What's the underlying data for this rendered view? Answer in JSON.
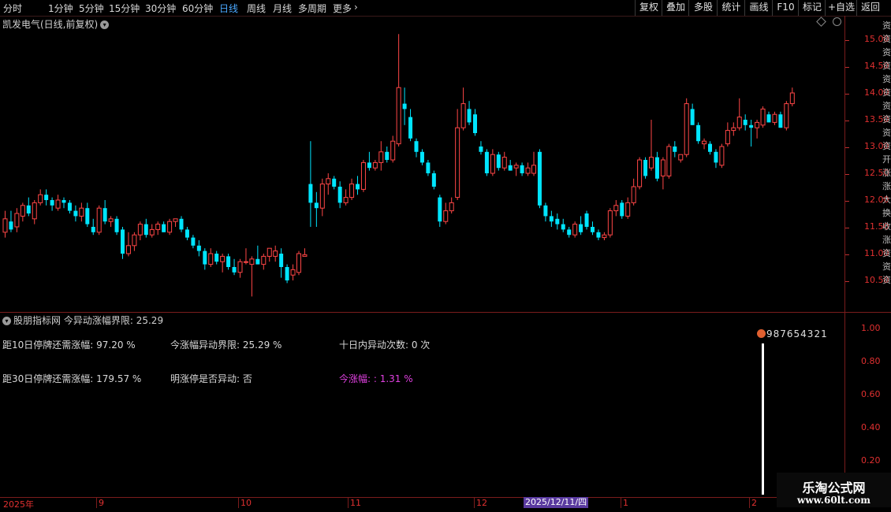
{
  "toolbar": {
    "periods": [
      "分时",
      "1分钟",
      "5分钟",
      "15分钟",
      "30分钟",
      "60分钟",
      "日线",
      "周线",
      "月线",
      "多周期",
      "更多"
    ],
    "active_period": "日线",
    "more_arrow": "›",
    "tools": [
      "复权",
      "叠加",
      "多股",
      "统计",
      "画线",
      "F10",
      "标记",
      "+自选",
      "返回"
    ]
  },
  "price_panel": {
    "title": "凯发电气(日线,前复权)",
    "dropdown_icon": "chevron-down-icon",
    "price_ticks": [
      "15.00",
      "14.50",
      "14.00",
      "13.50",
      "13.00",
      "12.50",
      "12.00",
      "11.50",
      "11.00",
      "10.50"
    ]
  },
  "indicator_panel": {
    "source": "股朋指标网",
    "title_label": "今异动涨幅界限",
    "title_value": "25.29",
    "line1_a": "距10日停牌还需涨幅: 97.20 %",
    "line1_b": "今涨幅异动界限: 25.29 %",
    "line1_c": "十日内异动次数: 0 次",
    "line2_a": "距30日停牌还需涨幅: 179.57 %",
    "line2_b": "明涨停是否异动: 否",
    "line2_c": "今涨幅: : 1.31 %",
    "signal_label": "987654321",
    "ticks": [
      "1.00",
      "0.80",
      "0.60",
      "0.40",
      "0.20"
    ]
  },
  "time_axis": {
    "labels": [
      "2025年",
      "9",
      "10",
      "11",
      "12",
      "1",
      "2"
    ],
    "cursor_date": "2025/12/11/四"
  },
  "right_strip_chars": [
    "资",
    "资",
    "资",
    "资",
    "资",
    "资",
    "资",
    "资",
    "资",
    "资",
    "开",
    "涨",
    "涨",
    "大",
    "换",
    "收",
    "涨",
    "资",
    "资",
    "资"
  ],
  "watermark": {
    "title": "乐淘公式网",
    "url": "www.60lt.com"
  },
  "colors": {
    "up": "#ff4646",
    "down": "#00e5ff",
    "axis": "#7a1c1c",
    "accent": "#4aa8ff",
    "magenta": "#e040e0"
  },
  "chart_data": {
    "type": "candlestick",
    "ylim": [
      10.0,
      15.3
    ],
    "candles": [
      {
        "o": 11.4,
        "h": 11.8,
        "l": 11.3,
        "c": 11.65
      },
      {
        "o": 11.6,
        "h": 11.8,
        "l": 11.4,
        "c": 11.45
      },
      {
        "o": 11.5,
        "h": 11.85,
        "l": 11.4,
        "c": 11.75
      },
      {
        "o": 11.7,
        "h": 11.95,
        "l": 11.6,
        "c": 11.9
      },
      {
        "o": 11.9,
        "h": 12.05,
        "l": 11.7,
        "c": 11.75
      },
      {
        "o": 11.65,
        "h": 12.0,
        "l": 11.55,
        "c": 11.95
      },
      {
        "o": 11.95,
        "h": 12.2,
        "l": 11.9,
        "c": 12.1
      },
      {
        "o": 12.1,
        "h": 12.2,
        "l": 11.9,
        "c": 12.0
      },
      {
        "o": 12.0,
        "h": 12.05,
        "l": 11.8,
        "c": 11.9
      },
      {
        "o": 11.85,
        "h": 12.1,
        "l": 11.8,
        "c": 12.0
      },
      {
        "o": 12.0,
        "h": 12.05,
        "l": 11.85,
        "c": 11.95
      },
      {
        "o": 11.95,
        "h": 12.0,
        "l": 11.75,
        "c": 11.8
      },
      {
        "o": 11.8,
        "h": 11.9,
        "l": 11.6,
        "c": 11.7
      },
      {
        "o": 11.7,
        "h": 11.95,
        "l": 11.6,
        "c": 11.85
      },
      {
        "o": 11.85,
        "h": 11.95,
        "l": 11.5,
        "c": 11.55
      },
      {
        "o": 11.5,
        "h": 11.65,
        "l": 11.35,
        "c": 11.4
      },
      {
        "o": 11.4,
        "h": 11.9,
        "l": 11.35,
        "c": 11.85
      },
      {
        "o": 11.85,
        "h": 12.0,
        "l": 11.55,
        "c": 11.6
      },
      {
        "o": 11.6,
        "h": 11.7,
        "l": 11.5,
        "c": 11.65
      },
      {
        "o": 11.65,
        "h": 11.7,
        "l": 11.35,
        "c": 11.4
      },
      {
        "o": 11.45,
        "h": 11.5,
        "l": 10.9,
        "c": 11.0
      },
      {
        "o": 11.0,
        "h": 11.4,
        "l": 10.95,
        "c": 11.15
      },
      {
        "o": 11.15,
        "h": 11.4,
        "l": 11.05,
        "c": 11.35
      },
      {
        "o": 11.35,
        "h": 11.6,
        "l": 11.25,
        "c": 11.55
      },
      {
        "o": 11.55,
        "h": 11.65,
        "l": 11.3,
        "c": 11.35
      },
      {
        "o": 11.35,
        "h": 11.55,
        "l": 11.3,
        "c": 11.45
      },
      {
        "o": 11.45,
        "h": 11.6,
        "l": 11.35,
        "c": 11.55
      },
      {
        "o": 11.55,
        "h": 11.6,
        "l": 11.4,
        "c": 11.4
      },
      {
        "o": 11.4,
        "h": 11.65,
        "l": 11.35,
        "c": 11.6
      },
      {
        "o": 11.6,
        "h": 11.65,
        "l": 11.5,
        "c": 11.65
      },
      {
        "o": 11.65,
        "h": 11.7,
        "l": 11.4,
        "c": 11.45
      },
      {
        "o": 11.45,
        "h": 11.5,
        "l": 11.25,
        "c": 11.3
      },
      {
        "o": 11.3,
        "h": 11.35,
        "l": 11.1,
        "c": 11.15
      },
      {
        "o": 11.15,
        "h": 11.25,
        "l": 10.95,
        "c": 11.05
      },
      {
        "o": 11.05,
        "h": 11.1,
        "l": 10.7,
        "c": 10.8
      },
      {
        "o": 10.8,
        "h": 11.1,
        "l": 10.75,
        "c": 11.0
      },
      {
        "o": 11.0,
        "h": 11.05,
        "l": 10.8,
        "c": 10.85
      },
      {
        "o": 10.85,
        "h": 11.0,
        "l": 10.65,
        "c": 10.95
      },
      {
        "o": 10.95,
        "h": 11.0,
        "l": 10.7,
        "c": 10.75
      },
      {
        "o": 10.75,
        "h": 10.9,
        "l": 10.6,
        "c": 10.65
      },
      {
        "o": 10.65,
        "h": 10.9,
        "l": 10.55,
        "c": 10.85
      },
      {
        "o": 10.85,
        "h": 11.1,
        "l": 10.8,
        "c": 10.85
      },
      {
        "o": 10.8,
        "h": 10.95,
        "l": 10.2,
        "c": 10.9
      },
      {
        "o": 10.9,
        "h": 11.15,
        "l": 10.8,
        "c": 10.8
      },
      {
        "o": 10.8,
        "h": 11.0,
        "l": 10.7,
        "c": 10.95
      },
      {
        "o": 10.95,
        "h": 11.1,
        "l": 10.85,
        "c": 11.1
      },
      {
        "o": 10.95,
        "h": 11.15,
        "l": 10.85,
        "c": 11.05
      },
      {
        "o": 11.0,
        "h": 11.1,
        "l": 10.55,
        "c": 10.75
      },
      {
        "o": 10.75,
        "h": 10.8,
        "l": 10.45,
        "c": 10.5
      },
      {
        "o": 10.6,
        "h": 10.8,
        "l": 10.5,
        "c": 10.7
      },
      {
        "o": 10.65,
        "h": 11.05,
        "l": 10.6,
        "c": 11.0
      },
      {
        "o": 10.95,
        "h": 11.1,
        "l": 10.95,
        "c": 10.98
      },
      {
        "o": 12.3,
        "h": 13.1,
        "l": 11.5,
        "c": 11.95
      },
      {
        "o": 11.95,
        "h": 12.15,
        "l": 11.5,
        "c": 11.85
      },
      {
        "o": 11.85,
        "h": 12.4,
        "l": 11.7,
        "c": 12.3
      },
      {
        "o": 12.3,
        "h": 12.5,
        "l": 12.1,
        "c": 12.4
      },
      {
        "o": 12.4,
        "h": 12.45,
        "l": 12.2,
        "c": 12.25
      },
      {
        "o": 12.25,
        "h": 12.35,
        "l": 11.85,
        "c": 11.95
      },
      {
        "o": 11.95,
        "h": 12.2,
        "l": 11.9,
        "c": 12.05
      },
      {
        "o": 12.05,
        "h": 12.4,
        "l": 12.0,
        "c": 12.3
      },
      {
        "o": 12.3,
        "h": 12.45,
        "l": 12.1,
        "c": 12.2
      },
      {
        "o": 12.2,
        "h": 12.75,
        "l": 12.15,
        "c": 12.7
      },
      {
        "o": 12.7,
        "h": 12.9,
        "l": 12.55,
        "c": 12.6
      },
      {
        "o": 12.6,
        "h": 12.75,
        "l": 12.55,
        "c": 12.7
      },
      {
        "o": 12.7,
        "h": 13.1,
        "l": 12.55,
        "c": 12.9
      },
      {
        "o": 12.9,
        "h": 13.0,
        "l": 12.7,
        "c": 12.75
      },
      {
        "o": 12.75,
        "h": 13.2,
        "l": 12.7,
        "c": 13.1
      },
      {
        "o": 13.05,
        "h": 15.1,
        "l": 13.0,
        "c": 14.1
      },
      {
        "o": 13.8,
        "h": 14.1,
        "l": 13.4,
        "c": 13.7
      },
      {
        "o": 13.55,
        "h": 13.7,
        "l": 13.1,
        "c": 13.15
      },
      {
        "o": 13.1,
        "h": 13.15,
        "l": 12.8,
        "c": 12.9
      },
      {
        "o": 12.9,
        "h": 12.95,
        "l": 12.65,
        "c": 12.7
      },
      {
        "o": 12.7,
        "h": 12.75,
        "l": 12.45,
        "c": 12.5
      },
      {
        "o": 12.5,
        "h": 12.55,
        "l": 12.2,
        "c": 12.25
      },
      {
        "o": 12.05,
        "h": 12.1,
        "l": 11.5,
        "c": 11.6
      },
      {
        "o": 11.6,
        "h": 11.95,
        "l": 11.55,
        "c": 11.8
      },
      {
        "o": 11.8,
        "h": 12.05,
        "l": 11.75,
        "c": 11.95
      },
      {
        "o": 12.05,
        "h": 13.7,
        "l": 12.0,
        "c": 13.35
      },
      {
        "o": 13.35,
        "h": 14.1,
        "l": 13.3,
        "c": 13.8
      },
      {
        "o": 13.7,
        "h": 13.85,
        "l": 13.4,
        "c": 13.45
      },
      {
        "o": 13.6,
        "h": 13.7,
        "l": 13.2,
        "c": 13.25
      },
      {
        "o": 13.0,
        "h": 13.1,
        "l": 12.85,
        "c": 12.9
      },
      {
        "o": 12.9,
        "h": 12.95,
        "l": 12.45,
        "c": 12.5
      },
      {
        "o": 12.5,
        "h": 12.95,
        "l": 12.45,
        "c": 12.85
      },
      {
        "o": 12.85,
        "h": 12.9,
        "l": 12.55,
        "c": 12.6
      },
      {
        "o": 12.6,
        "h": 12.9,
        "l": 12.55,
        "c": 12.8
      },
      {
        "o": 12.65,
        "h": 12.75,
        "l": 12.55,
        "c": 12.55
      },
      {
        "o": 12.6,
        "h": 12.7,
        "l": 12.45,
        "c": 12.65
      },
      {
        "o": 12.65,
        "h": 12.7,
        "l": 12.45,
        "c": 12.5
      },
      {
        "o": 12.5,
        "h": 12.7,
        "l": 12.45,
        "c": 12.6
      },
      {
        "o": 12.5,
        "h": 12.9,
        "l": 12.45,
        "c": 12.65
      },
      {
        "o": 12.9,
        "h": 12.95,
        "l": 11.85,
        "c": 11.9
      },
      {
        "o": 11.9,
        "h": 11.95,
        "l": 11.6,
        "c": 11.7
      },
      {
        "o": 11.7,
        "h": 11.8,
        "l": 11.5,
        "c": 11.6
      },
      {
        "o": 11.65,
        "h": 11.75,
        "l": 11.45,
        "c": 11.55
      },
      {
        "o": 11.55,
        "h": 11.65,
        "l": 11.4,
        "c": 11.45
      },
      {
        "o": 11.45,
        "h": 11.5,
        "l": 11.3,
        "c": 11.35
      },
      {
        "o": 11.35,
        "h": 11.6,
        "l": 11.3,
        "c": 11.55
      },
      {
        "o": 11.55,
        "h": 11.7,
        "l": 11.35,
        "c": 11.4
      },
      {
        "o": 11.75,
        "h": 11.8,
        "l": 11.45,
        "c": 11.5
      },
      {
        "o": 11.5,
        "h": 11.6,
        "l": 11.35,
        "c": 11.4
      },
      {
        "o": 11.4,
        "h": 11.45,
        "l": 11.25,
        "c": 11.3
      },
      {
        "o": 11.3,
        "h": 11.4,
        "l": 11.25,
        "c": 11.35
      },
      {
        "o": 11.35,
        "h": 11.85,
        "l": 11.3,
        "c": 11.8
      },
      {
        "o": 11.8,
        "h": 12.0,
        "l": 11.7,
        "c": 11.9
      },
      {
        "o": 11.95,
        "h": 12.0,
        "l": 11.65,
        "c": 11.7
      },
      {
        "o": 11.7,
        "h": 12.05,
        "l": 11.65,
        "c": 11.95
      },
      {
        "o": 11.95,
        "h": 12.4,
        "l": 11.9,
        "c": 12.25
      },
      {
        "o": 12.25,
        "h": 12.8,
        "l": 12.2,
        "c": 12.75
      },
      {
        "o": 12.75,
        "h": 12.8,
        "l": 12.4,
        "c": 12.45
      },
      {
        "o": 12.6,
        "h": 13.5,
        "l": 12.55,
        "c": 12.8
      },
      {
        "o": 12.8,
        "h": 12.9,
        "l": 12.35,
        "c": 12.4
      },
      {
        "o": 12.45,
        "h": 12.8,
        "l": 12.2,
        "c": 12.75
      },
      {
        "o": 12.45,
        "h": 13.05,
        "l": 12.4,
        "c": 13.0
      },
      {
        "o": 13.0,
        "h": 13.1,
        "l": 12.8,
        "c": 12.9
      },
      {
        "o": 12.75,
        "h": 12.85,
        "l": 12.7,
        "c": 12.85
      },
      {
        "o": 12.85,
        "h": 13.9,
        "l": 12.8,
        "c": 13.8
      },
      {
        "o": 13.7,
        "h": 13.8,
        "l": 13.4,
        "c": 13.4
      },
      {
        "o": 13.4,
        "h": 13.45,
        "l": 13.05,
        "c": 13.1
      },
      {
        "o": 13.05,
        "h": 13.15,
        "l": 12.95,
        "c": 13.1
      },
      {
        "o": 13.05,
        "h": 13.1,
        "l": 12.85,
        "c": 12.9
      },
      {
        "o": 12.9,
        "h": 12.95,
        "l": 12.6,
        "c": 12.7
      },
      {
        "o": 12.65,
        "h": 13.05,
        "l": 12.6,
        "c": 13.0
      },
      {
        "o": 13.05,
        "h": 13.45,
        "l": 13.0,
        "c": 13.3
      },
      {
        "o": 13.3,
        "h": 13.45,
        "l": 13.2,
        "c": 13.35
      },
      {
        "o": 13.35,
        "h": 13.9,
        "l": 13.3,
        "c": 13.55
      },
      {
        "o": 13.5,
        "h": 13.6,
        "l": 13.3,
        "c": 13.4
      },
      {
        "o": 13.4,
        "h": 13.5,
        "l": 13.0,
        "c": 13.35
      },
      {
        "o": 13.35,
        "h": 13.5,
        "l": 13.15,
        "c": 13.45
      },
      {
        "o": 13.4,
        "h": 13.75,
        "l": 13.35,
        "c": 13.7
      },
      {
        "o": 13.6,
        "h": 13.65,
        "l": 13.45,
        "c": 13.45
      },
      {
        "o": 13.45,
        "h": 13.65,
        "l": 13.4,
        "c": 13.6
      },
      {
        "o": 13.6,
        "h": 13.65,
        "l": 13.35,
        "c": 13.35
      },
      {
        "o": 13.35,
        "h": 13.85,
        "l": 13.3,
        "c": 13.8
      },
      {
        "o": 13.8,
        "h": 14.1,
        "l": 13.75,
        "c": 14.0
      }
    ]
  }
}
